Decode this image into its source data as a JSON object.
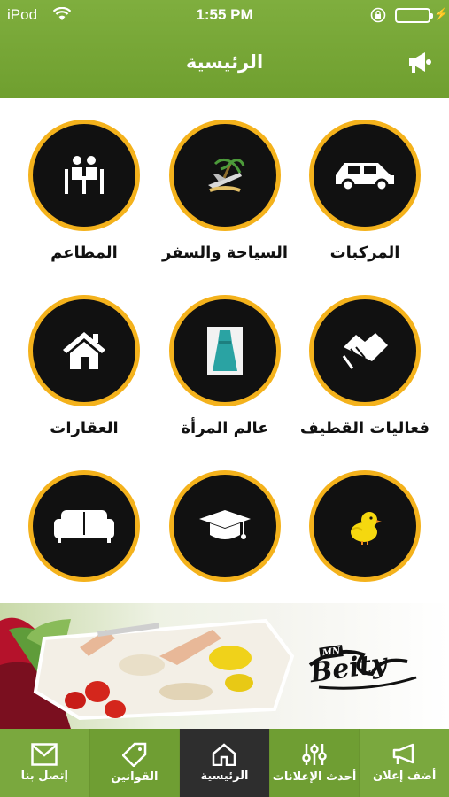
{
  "status_bar": {
    "carrier": "iPod",
    "time": "1:55 PM"
  },
  "header": {
    "title": "الرئيسية",
    "icon": "megaphone-icon"
  },
  "categories": [
    {
      "label": "المركبات",
      "icon": "car-icon"
    },
    {
      "label": "السياحة والسفر",
      "icon": "travel-icon"
    },
    {
      "label": "المطاعم",
      "icon": "restaurant-icon"
    },
    {
      "label": "فعاليات القطيف",
      "icon": "handshake-icon"
    },
    {
      "label": "عالم المرأة",
      "icon": "dress-icon"
    },
    {
      "label": "العقارات",
      "icon": "house-icon"
    },
    {
      "label": "",
      "icon": "chick-icon"
    },
    {
      "label": "",
      "icon": "graduation-cap-icon"
    },
    {
      "label": "",
      "icon": "sofa-icon"
    }
  ],
  "banner": {
    "brand": "Beity",
    "brand_prefix": "MN"
  },
  "tabs": [
    {
      "label": "إتصل بنا",
      "icon": "mail-icon"
    },
    {
      "label": "القوانين",
      "icon": "tag-icon"
    },
    {
      "label": "الرئيسية",
      "icon": "home-icon",
      "active": true
    },
    {
      "label": "أحدث الإعلانات",
      "icon": "sliders-icon"
    },
    {
      "label": "أضف إعلان",
      "icon": "megaphone-icon"
    }
  ],
  "colors": {
    "header_green": "#7aa83e",
    "ring_orange": "#f4b21c",
    "circle_black": "#111111",
    "active_tab": "#2e2e2e"
  }
}
